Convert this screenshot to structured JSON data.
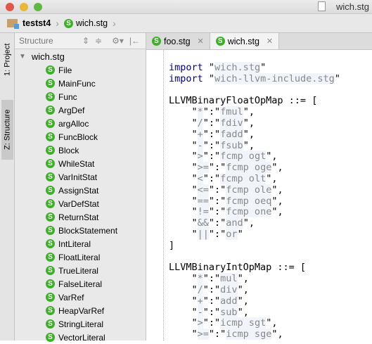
{
  "window": {
    "title": "wich.stg"
  },
  "breadcrumb": {
    "project": "testst4",
    "file": "wich.stg"
  },
  "left_strip": {
    "project_tab": "1: Project",
    "structure_tab": "Z: Structure"
  },
  "structure": {
    "title": "Structure",
    "root": "wich.stg",
    "items": [
      "File",
      "MainFunc",
      "Func",
      "ArgDef",
      "argAlloc",
      "FuncBlock",
      "Block",
      "WhileStat",
      "VarInitStat",
      "AssignStat",
      "VarDefStat",
      "ReturnStat",
      "BlockStatement",
      "IntLiteral",
      "FloatLiteral",
      "TrueLiteral",
      "FalseLiteral",
      "VarRef",
      "HeapVarRef",
      "StringLiteral",
      "VectorLiteral"
    ]
  },
  "tabs": [
    {
      "label": "foo.stg",
      "active": false
    },
    {
      "label": "wich.stg",
      "active": true
    }
  ],
  "code": [
    [
      [
        "import",
        "kw"
      ],
      [
        " \"",
        ""
      ],
      [
        "wich.stg",
        "str"
      ],
      [
        "\"",
        ""
      ]
    ],
    [
      [
        "import",
        "kw"
      ],
      [
        " \"",
        ""
      ],
      [
        "wich-llvm-include.stg",
        "str"
      ],
      [
        "\"",
        ""
      ]
    ],
    [],
    [
      [
        "LLVMBinaryFloatOpMap ::= [",
        ""
      ]
    ],
    [
      [
        "    \"",
        ""
      ],
      [
        "*",
        "str"
      ],
      [
        "\":\"",
        ""
      ],
      [
        "fmul",
        "str"
      ],
      [
        "\",",
        ""
      ]
    ],
    [
      [
        "    \"",
        ""
      ],
      [
        "/",
        "str"
      ],
      [
        "\":\"",
        ""
      ],
      [
        "fdiv",
        "str"
      ],
      [
        "\",",
        ""
      ]
    ],
    [
      [
        "    \"",
        ""
      ],
      [
        "+",
        "str"
      ],
      [
        "\":\"",
        ""
      ],
      [
        "fadd",
        "str"
      ],
      [
        "\",",
        ""
      ]
    ],
    [
      [
        "    \"",
        ""
      ],
      [
        "-",
        "str"
      ],
      [
        "\":\"",
        ""
      ],
      [
        "fsub",
        "str"
      ],
      [
        "\",",
        ""
      ]
    ],
    [
      [
        "    \"",
        ""
      ],
      [
        ">",
        "str"
      ],
      [
        "\":\"",
        ""
      ],
      [
        "fcmp ogt",
        "str"
      ],
      [
        "\",",
        ""
      ]
    ],
    [
      [
        "    \"",
        ""
      ],
      [
        ">=",
        "str"
      ],
      [
        "\":\"",
        ""
      ],
      [
        "fcmp oge",
        "str"
      ],
      [
        "\",",
        ""
      ]
    ],
    [
      [
        "    \"",
        ""
      ],
      [
        "<",
        "str"
      ],
      [
        "\":\"",
        ""
      ],
      [
        "fcmp olt",
        "str"
      ],
      [
        "\",",
        ""
      ]
    ],
    [
      [
        "    \"",
        ""
      ],
      [
        "<=",
        "str"
      ],
      [
        "\":\"",
        ""
      ],
      [
        "fcmp ole",
        "str"
      ],
      [
        "\",",
        ""
      ]
    ],
    [
      [
        "    \"",
        ""
      ],
      [
        "==",
        "str"
      ],
      [
        "\":\"",
        ""
      ],
      [
        "fcmp oeq",
        "str"
      ],
      [
        "\",",
        ""
      ]
    ],
    [
      [
        "    \"",
        ""
      ],
      [
        "!=",
        "str"
      ],
      [
        "\":\"",
        ""
      ],
      [
        "fcmp one",
        "str"
      ],
      [
        "\",",
        ""
      ]
    ],
    [
      [
        "    \"",
        ""
      ],
      [
        "&&",
        "str"
      ],
      [
        "\":\"",
        ""
      ],
      [
        "and",
        "str"
      ],
      [
        "\",",
        ""
      ]
    ],
    [
      [
        "    \"",
        ""
      ],
      [
        "||",
        "str"
      ],
      [
        "\":\"",
        ""
      ],
      [
        "or",
        "str"
      ],
      [
        "\"",
        ""
      ]
    ],
    [
      [
        "]",
        ""
      ]
    ],
    [],
    [
      [
        "LLVMBinaryIntOpMap ::= [",
        ""
      ]
    ],
    [
      [
        "    \"",
        ""
      ],
      [
        "*",
        "str"
      ],
      [
        "\":\"",
        ""
      ],
      [
        "mul",
        "str"
      ],
      [
        "\",",
        ""
      ]
    ],
    [
      [
        "    \"",
        ""
      ],
      [
        "/",
        "str"
      ],
      [
        "\":\"",
        ""
      ],
      [
        "div",
        "str"
      ],
      [
        "\",",
        ""
      ]
    ],
    [
      [
        "    \"",
        ""
      ],
      [
        "+",
        "str"
      ],
      [
        "\":\"",
        ""
      ],
      [
        "add",
        "str"
      ],
      [
        "\",",
        ""
      ]
    ],
    [
      [
        "    \"",
        ""
      ],
      [
        "-",
        "str"
      ],
      [
        "\":\"",
        ""
      ],
      [
        "sub",
        "str"
      ],
      [
        "\",",
        ""
      ]
    ],
    [
      [
        "    \"",
        ""
      ],
      [
        ">",
        "str"
      ],
      [
        "\":\"",
        ""
      ],
      [
        "icmp sgt",
        "str"
      ],
      [
        "\",",
        ""
      ]
    ],
    [
      [
        "    \"",
        ""
      ],
      [
        ">=",
        "str"
      ],
      [
        "\":\"",
        ""
      ],
      [
        "icmp sge",
        "str"
      ],
      [
        "\",",
        ""
      ]
    ]
  ]
}
